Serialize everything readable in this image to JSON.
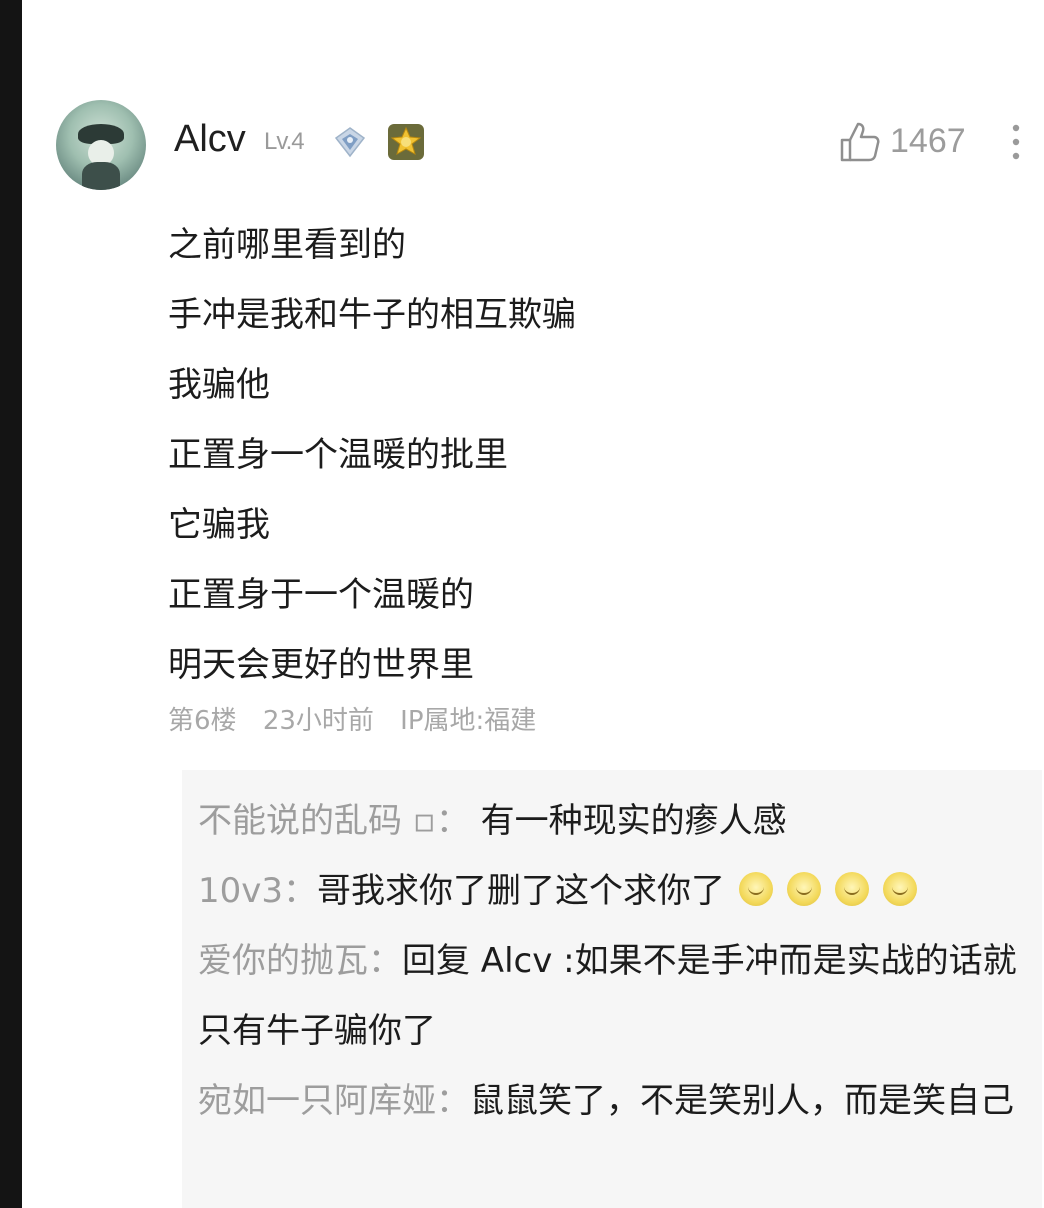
{
  "comment": {
    "username": "Alcv",
    "level": "Lv.4",
    "likes": "1467",
    "lines": [
      "之前哪里看到的",
      "手冲是我和牛子的相互欺骗",
      "我骗他",
      "正置身一个温暖的批里",
      "它骗我",
      "正置身于一个温暖的",
      "明天会更好的世界里"
    ],
    "meta": {
      "floor": "第6楼",
      "time": "23小时前",
      "location": "IP属地:福建"
    }
  },
  "replies": [
    {
      "author": "不能说的乱码 ▫：",
      "text": " 有一种现实的瘆人感"
    },
    {
      "author": "10v3：",
      "text": "哥我求你了删了这个求你了",
      "emoji_count": 4
    },
    {
      "author": "爱你的抛瓦：",
      "text": "回复 Alcv :如果不是手冲而是实战的话就只有牛子骗你了"
    },
    {
      "author": "宛如一只阿库娅：",
      "text": "鼠鼠笑了，不是笑别人，而是笑自己"
    }
  ],
  "icons": {
    "avatar": "avatar-image",
    "gem": "gem-icon",
    "medal": "medal-icon",
    "like": "thumbs-up-icon",
    "more": "more-vertical-icon",
    "emoji": "grin-emoji-icon"
  }
}
